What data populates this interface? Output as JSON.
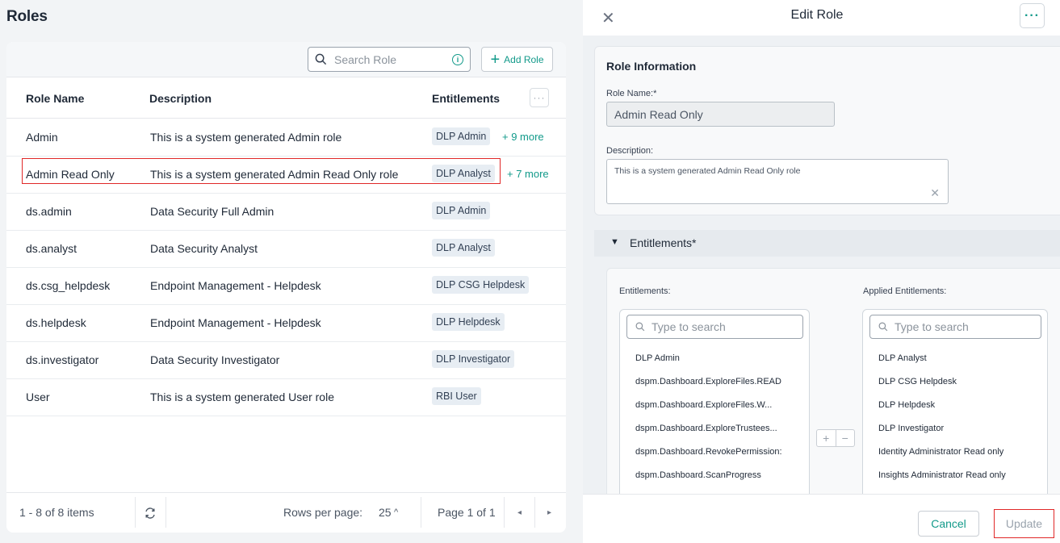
{
  "roles": {
    "title": "Roles",
    "search": {
      "placeholder": "Search Role"
    },
    "add_role_label": "Add Role",
    "columns": {
      "name": "Role Name",
      "description": "Description",
      "entitlements": "Entitlements"
    },
    "rows": [
      {
        "name": "Admin",
        "description": "This is a system generated Admin role",
        "badge": "DLP Admin",
        "more": "+ 9 more"
      },
      {
        "name": "Admin Read Only",
        "description": "This is a system generated Admin Read Only role",
        "badge": "DLP Analyst",
        "more": "+ 7 more"
      },
      {
        "name": "ds.admin",
        "description": "Data Security Full Admin",
        "badge": "DLP Admin",
        "more": ""
      },
      {
        "name": "ds.analyst",
        "description": "Data Security Analyst",
        "badge": "DLP Analyst",
        "more": ""
      },
      {
        "name": "ds.csg_helpdesk",
        "description": "Endpoint Management - Helpdesk",
        "badge": "DLP CSG Helpdesk",
        "more": ""
      },
      {
        "name": "ds.helpdesk",
        "description": "Endpoint Management - Helpdesk",
        "badge": "DLP Helpdesk",
        "more": ""
      },
      {
        "name": "ds.investigator",
        "description": "Data Security Investigator",
        "badge": "DLP Investigator",
        "more": ""
      },
      {
        "name": "User",
        "description": "This is a system generated User role",
        "badge": "RBI User",
        "more": ""
      }
    ],
    "pager": {
      "count": "1 - 8 of 8 items",
      "rows_per_page_label": "Rows per page:",
      "rows_per_page_value": "25",
      "page": "Page 1 of 1"
    }
  },
  "edit_role": {
    "title": "Edit Role",
    "section_title": "Role Information",
    "name_label": "Role Name:*",
    "name_value": "Admin Read Only",
    "description_label": "Description:",
    "description_value": "This is a system generated Admin Read Only role",
    "entitlements_header": "Entitlements*",
    "available_label": "Entitlements:",
    "applied_label": "Applied Entitlements:",
    "search_placeholder": "Type to search",
    "available": [
      "DLP Admin",
      "dspm.Dashboard.ExploreFiles.READ",
      "dspm.Dashboard.ExploreFiles.W...",
      "dspm.Dashboard.ExploreTrustees...",
      "dspm.Dashboard.RevokePermission:",
      "dspm.Dashboard.ScanProgress"
    ],
    "applied": [
      "DLP Analyst",
      "DLP CSG Helpdesk",
      "DLP Helpdesk",
      "DLP Investigator",
      "Identity Administrator Read only",
      "Insights Administrator Read only"
    ],
    "cancel_label": "Cancel",
    "update_label": "Update"
  },
  "colors": {
    "accent": "#129a8a",
    "highlight": "#e02828"
  },
  "icons": [
    "search-icon",
    "info-icon",
    "plus-icon",
    "more-icon",
    "refresh-icon",
    "caret-up-icon",
    "prev-page-icon",
    "next-page-icon",
    "close-icon",
    "kebab-icon",
    "collapse-triangle-icon",
    "clear-icon",
    "add-icon",
    "remove-icon"
  ]
}
